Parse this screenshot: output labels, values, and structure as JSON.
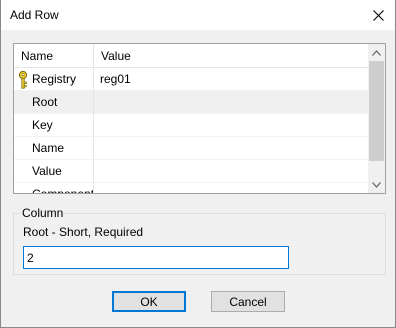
{
  "window": {
    "title": "Add Row"
  },
  "grid": {
    "columns": [
      "Name",
      "Value"
    ],
    "rows": [
      {
        "name": "Registry",
        "value": "reg01",
        "icon": "key-icon"
      },
      {
        "name": "Root",
        "value": "",
        "selected": true
      },
      {
        "name": "Key",
        "value": ""
      },
      {
        "name": "Name",
        "value": ""
      },
      {
        "name": "Value",
        "value": ""
      },
      {
        "name": "Component",
        "value": ""
      }
    ]
  },
  "column_group": {
    "legend": "Column",
    "description": "Root - Short, Required",
    "input_value": "2"
  },
  "buttons": {
    "ok": "OK",
    "cancel": "Cancel"
  },
  "colors": {
    "accent": "#0078d7",
    "selected_row": "#f0f0f0",
    "key_icon": "#e6c619"
  }
}
